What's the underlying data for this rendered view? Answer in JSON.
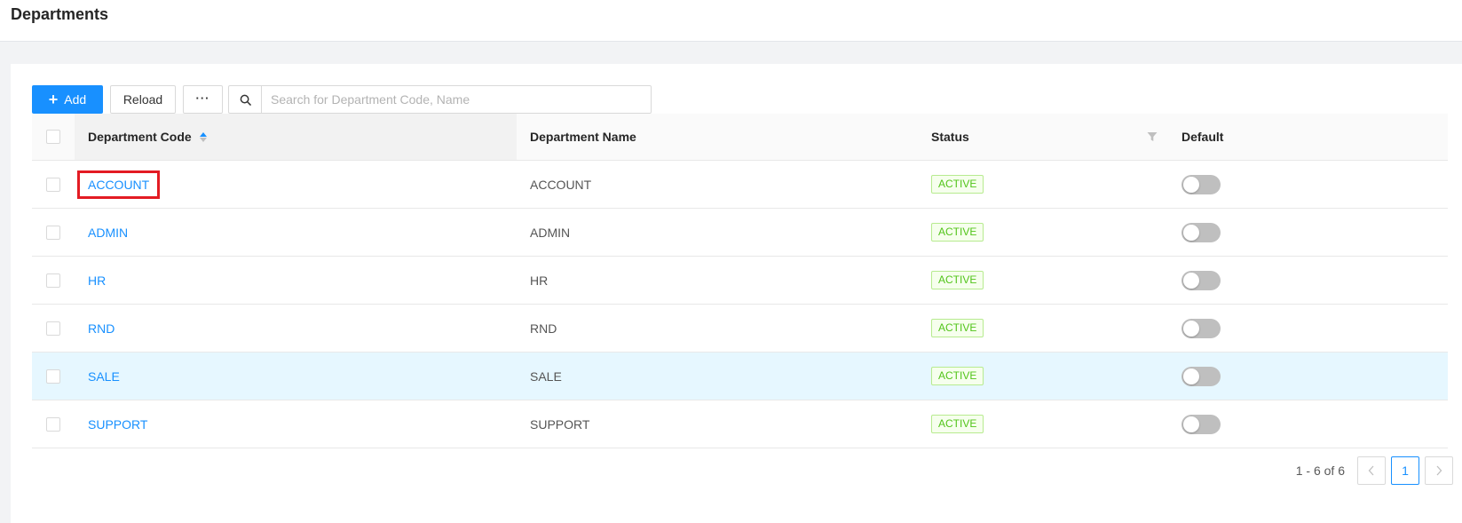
{
  "header": {
    "title": "Departments"
  },
  "toolbar": {
    "add_icon": "+",
    "add_label": "Add",
    "reload_label": "Reload",
    "more_label": "···",
    "search_icon": "search-icon",
    "search_placeholder": "Search for Department Code, Name"
  },
  "table": {
    "columns": {
      "code": "Department Code",
      "name": "Department Name",
      "status": "Status",
      "default": "Default"
    },
    "rows": [
      {
        "code": "ACCOUNT",
        "name": "ACCOUNT",
        "status": "ACTIVE"
      },
      {
        "code": "ADMIN",
        "name": "ADMIN",
        "status": "ACTIVE"
      },
      {
        "code": "HR",
        "name": "HR",
        "status": "ACTIVE"
      },
      {
        "code": "RND",
        "name": "RND",
        "status": "ACTIVE"
      },
      {
        "code": "SALE",
        "name": "SALE",
        "status": "ACTIVE"
      },
      {
        "code": "SUPPORT",
        "name": "SUPPORT",
        "status": "ACTIVE"
      }
    ]
  },
  "pagination": {
    "info": "1 - 6 of 6",
    "prev": "<",
    "current": "1",
    "next": ">"
  },
  "colors": {
    "primary": "#1890ff",
    "active_tag": "#52c41a",
    "highlight": "#e31b23",
    "hover_row": "#e6f7ff"
  }
}
